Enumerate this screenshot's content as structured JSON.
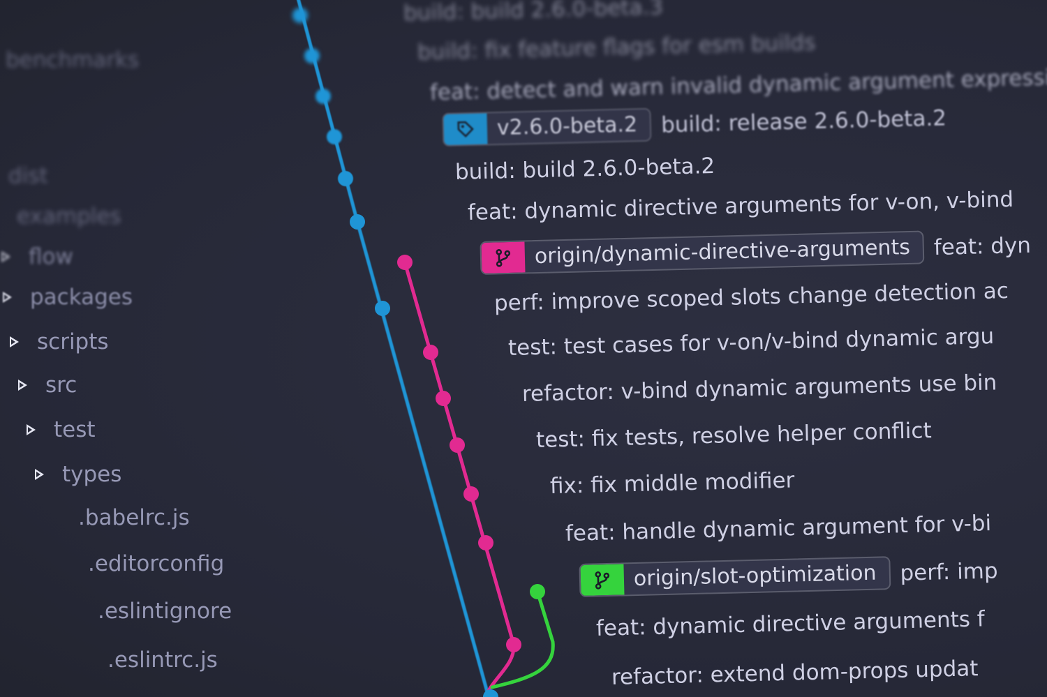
{
  "sidebar": {
    "items": [
      {
        "label": "benchmarks",
        "has_arrow": false
      },
      {
        "label": "dist",
        "has_arrow": false
      },
      {
        "label": "examples",
        "has_arrow": false
      },
      {
        "label": "flow",
        "has_arrow": true
      },
      {
        "label": "packages",
        "has_arrow": true
      },
      {
        "label": "scripts",
        "has_arrow": true
      },
      {
        "label": "src",
        "has_arrow": true
      },
      {
        "label": "test",
        "has_arrow": true
      },
      {
        "label": "types",
        "has_arrow": true
      },
      {
        "label": ".babelrc.js",
        "has_arrow": false
      },
      {
        "label": ".editorconfig",
        "has_arrow": false
      },
      {
        "label": ".eslintignore",
        "has_arrow": false
      },
      {
        "label": ".eslintrc.js",
        "has_arrow": false
      }
    ]
  },
  "commits": [
    {
      "message": "build: build 2.6.0-beta.3"
    },
    {
      "message": "build: fix feature flags for esm builds"
    },
    {
      "message": "feat: detect and warn invalid dynamic argument expressions"
    },
    {
      "tag": {
        "label": "v2.6.0-beta.2",
        "color": "blue",
        "icon": "tag-icon"
      },
      "message": "build: release 2.6.0-beta.2"
    },
    {
      "message": "build: build 2.6.0-beta.2"
    },
    {
      "message": "feat: dynamic directive arguments for v-on, v-bind"
    },
    {
      "tag": {
        "label": "origin/dynamic-directive-arguments",
        "color": "pink",
        "icon": "branch-icon"
      },
      "message": "feat: dyn"
    },
    {
      "message": "perf: improve scoped slots change detection ac"
    },
    {
      "message": "test: test cases for v-on/v-bind dynamic argu"
    },
    {
      "message": "refactor: v-bind dynamic arguments use bin"
    },
    {
      "message": "test: fix tests, resolve helper conflict"
    },
    {
      "message": "fix: fix middle modifier"
    },
    {
      "message": "feat: handle dynamic argument for v-bi"
    },
    {
      "tag": {
        "label": "origin/slot-optimization",
        "color": "green",
        "icon": "branch-icon"
      },
      "message": "perf: imp"
    },
    {
      "message": "feat: dynamic directive arguments f"
    },
    {
      "message": "refactor: extend dom-props updat"
    }
  ],
  "colors": {
    "background": "#2a2c3b",
    "branch_blue": "#1f95d6",
    "branch_pink": "#e22a91",
    "branch_green": "#35d33d"
  }
}
